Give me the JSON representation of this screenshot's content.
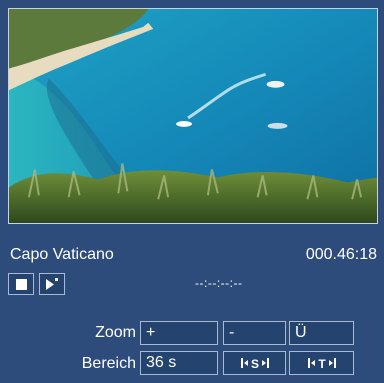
{
  "clip": {
    "title": "Capo Vaticano",
    "duration": "000.46:18",
    "position_display": "--:--:--:--"
  },
  "zoom": {
    "label": "Zoom",
    "plus": "+",
    "minus": "-",
    "full": "Ü"
  },
  "range": {
    "label": "Bereich",
    "value": "36 s"
  },
  "icons": {
    "stop": "stop-icon",
    "play": "play-icon",
    "scene": "scene-marker-icon",
    "title": "title-marker-icon"
  },
  "colors": {
    "background": "#2d4c7b",
    "field": "#24436f",
    "border": "#a9bad3",
    "text": "#ffffff"
  }
}
